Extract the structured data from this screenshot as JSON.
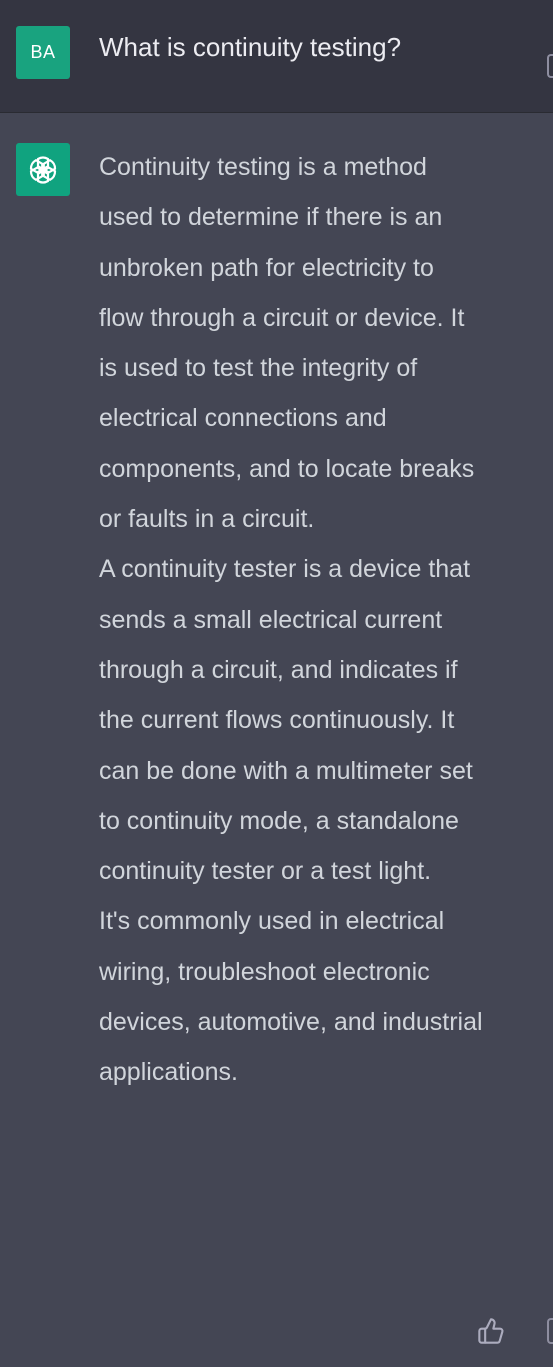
{
  "user_message": {
    "avatar_initials": "BA",
    "text": "What is continuity testing?"
  },
  "assistant_message": {
    "avatar_icon": "openai-logo-icon",
    "paragraphs": [
      "Continuity testing is a method used to determine if there is an unbroken path for electricity to flow through a circuit or device. It is used to test the integrity of electrical connections and components, and to locate breaks or faults in a circuit.",
      "A continuity tester is a device that sends a small electrical current through a circuit, and indicates if the current flows continuously. It can be done with a multimeter set to continuity mode, a standalone continuity tester or a test light.",
      "It's commonly used in electrical wiring, troubleshoot electronic devices, automotive, and industrial applications."
    ]
  },
  "actions": {
    "thumbs_up_icon": "thumbs-up-icon"
  },
  "colors": {
    "user_bg": "#343541",
    "assistant_bg": "#444654",
    "user_avatar": "#19a37f",
    "bot_avatar": "#10a37f",
    "text": "#d1d5db"
  }
}
